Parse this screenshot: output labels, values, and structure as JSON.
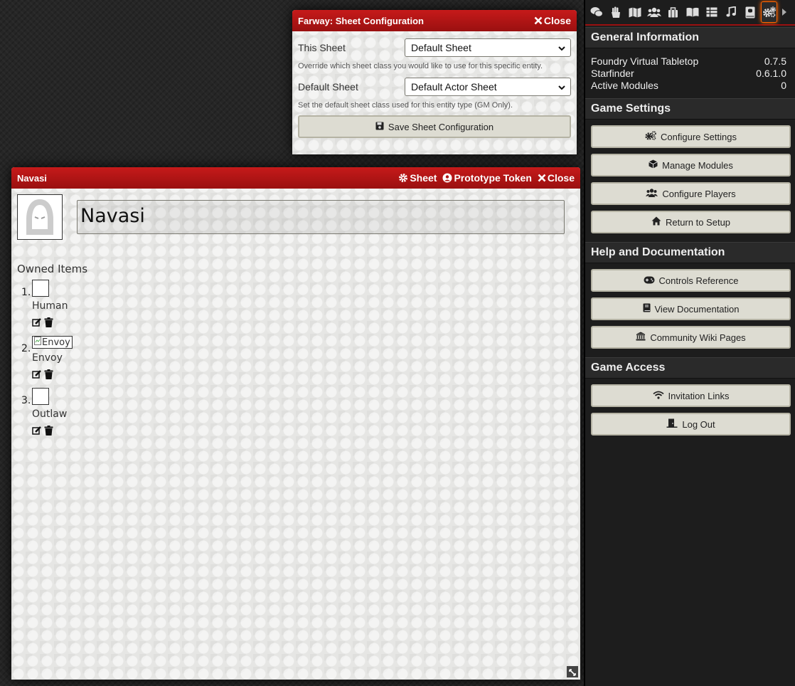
{
  "config_window": {
    "title": "Farway: Sheet Configuration",
    "close_label": "Close",
    "this_sheet_label": "This Sheet",
    "this_sheet_value": "Default Sheet",
    "this_sheet_hint": "Override which sheet class you would like to use for this specific entity.",
    "default_sheet_label": "Default Sheet",
    "default_sheet_value": "Default Actor Sheet",
    "default_sheet_hint": "Set the default sheet class used for this entity type (GM Only).",
    "save_label": "Save Sheet Configuration"
  },
  "sheet_window": {
    "title": "Navasi",
    "sheet_label": "Sheet",
    "token_label": "Prototype Token",
    "close_label": "Close",
    "actor_name": "Navasi",
    "owned_items_label": "Owned Items",
    "items": [
      {
        "num": "1.",
        "name": "Human",
        "img_alt": ""
      },
      {
        "num": "2.",
        "name": "Envoy",
        "img_alt": "Envoy"
      },
      {
        "num": "3.",
        "name": "Outlaw",
        "img_alt": ""
      }
    ]
  },
  "sidebar": {
    "tabs": [
      "chat-icon",
      "combat-icon",
      "scenes-icon",
      "actors-icon",
      "items-icon",
      "journal-icon",
      "tables-icon",
      "playlists-icon",
      "compendium-icon",
      "settings-icon"
    ],
    "active_tab": "settings-icon",
    "general_info": {
      "heading": "General Information",
      "rows": [
        {
          "label": "Foundry Virtual Tabletop",
          "value": "0.7.5"
        },
        {
          "label": "Starfinder",
          "value": "0.6.1.0"
        },
        {
          "label": "Active Modules",
          "value": "0"
        }
      ]
    },
    "game_settings": {
      "heading": "Game Settings",
      "buttons": [
        "Configure Settings",
        "Manage Modules",
        "Configure Players",
        "Return to Setup"
      ]
    },
    "help": {
      "heading": "Help and Documentation",
      "buttons": [
        "Controls Reference",
        "View Documentation",
        "Community Wiki Pages"
      ]
    },
    "access": {
      "heading": "Game Access",
      "buttons": [
        "Invitation Links",
        "Log Out"
      ]
    }
  }
}
